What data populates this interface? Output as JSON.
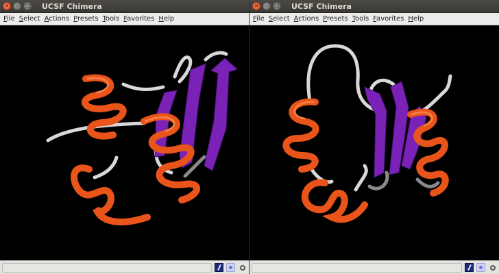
{
  "windows": [
    {
      "title": "UCSF Chimera",
      "menu": [
        "File",
        "Select",
        "Actions",
        "Presets",
        "Tools",
        "Favorites",
        "Help"
      ]
    },
    {
      "title": "UCSF Chimera",
      "menu": [
        "File",
        "Select",
        "Actions",
        "Presets",
        "Tools",
        "Favorites",
        "Help"
      ]
    }
  ],
  "colors": {
    "helix": "#e8541a",
    "sheet": "#7a22b8",
    "coil": "#d9d9d9",
    "viewport_bg": "#000000"
  },
  "icons": {
    "close": "close-icon",
    "minimize": "minimize-icon",
    "maximize": "maximize-icon",
    "command_line": "command-line-icon",
    "idle_status": "idle-status-icon",
    "search": "search-icon"
  }
}
